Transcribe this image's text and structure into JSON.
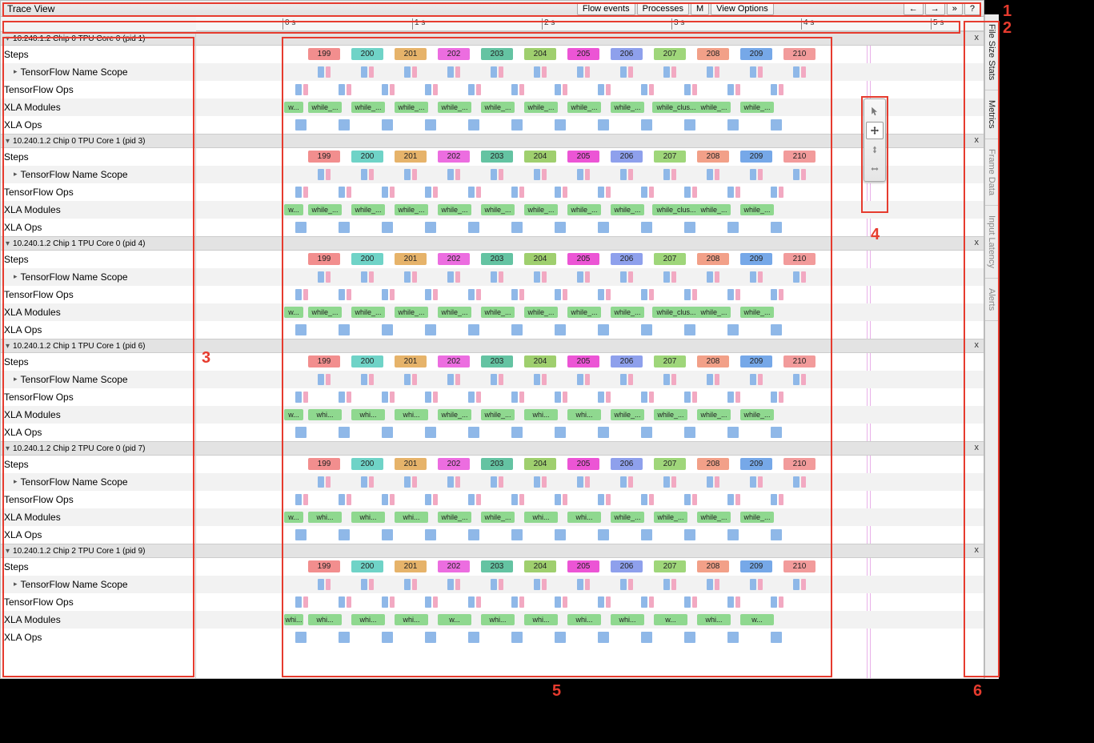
{
  "topbar": {
    "title": "Trace View",
    "buttons": {
      "flow": "Flow events",
      "processes": "Processes",
      "m": "M",
      "view": "View Options",
      "back": "←",
      "fwd": "→",
      "more": "»",
      "help": "?"
    }
  },
  "ruler": {
    "ticks": [
      "0 s",
      "1 s",
      "2 s",
      "3 s",
      "4 s",
      "5 s"
    ]
  },
  "processes": [
    {
      "name": "10.240.1.2 Chip 0 TPU Core 0 (pid 1)",
      "variant": "a"
    },
    {
      "name": "10.240.1.2 Chip 0 TPU Core 1 (pid 3)",
      "variant": "a"
    },
    {
      "name": "10.240.1.2 Chip 1 TPU Core 0 (pid 4)",
      "variant": "a"
    },
    {
      "name": "10.240.1.2 Chip 1 TPU Core 1 (pid 6)",
      "variant": "b"
    },
    {
      "name": "10.240.1.2 Chip 2 TPU Core 0 (pid 7)",
      "variant": "b"
    },
    {
      "name": "10.240.1.2 Chip 2 TPU Core 1 (pid 9)",
      "variant": "c"
    }
  ],
  "trackLabels": {
    "steps": "Steps",
    "ns": "TensorFlow Name Scope",
    "ops": "TensorFlow Ops",
    "xm": "XLA Modules",
    "xo": "XLA Ops"
  },
  "steps": [
    "199",
    "200",
    "201",
    "202",
    "203",
    "204",
    "205",
    "206",
    "207",
    "208",
    "209",
    "210"
  ],
  "xla_variants": {
    "a": [
      "w...",
      "while_...",
      "while_...",
      "while_...",
      "while_...",
      "while_...",
      "while_...",
      "while_...",
      "while_...",
      "while_clus...",
      "while_...",
      "while_..."
    ],
    "b": [
      "w...",
      "whi...",
      "whi...",
      "whi...",
      "while_...",
      "while_...",
      "whi...",
      "whi...",
      "while_...",
      "while_...",
      "while_...",
      "while_..."
    ],
    "c": [
      "whi...",
      "whi...",
      "whi...",
      "whi...",
      "w...",
      "whi...",
      "whi...",
      "whi...",
      "whi...",
      "w...",
      "whi...",
      "w...",
      "whi..."
    ]
  },
  "closeLabel": "x",
  "vtabs": [
    "File Size Stats",
    "Metrics",
    "Frame Data",
    "Input Latency",
    "Alerts"
  ],
  "toolbox": {
    "select": "select-tool",
    "pan": "pan-tool",
    "zoom": "zoom-tool",
    "timing": "timing-tool"
  },
  "annotations": {
    "n1": "1",
    "n2": "2",
    "n3": "3",
    "n4": "4",
    "n5": "5",
    "n6": "6"
  }
}
